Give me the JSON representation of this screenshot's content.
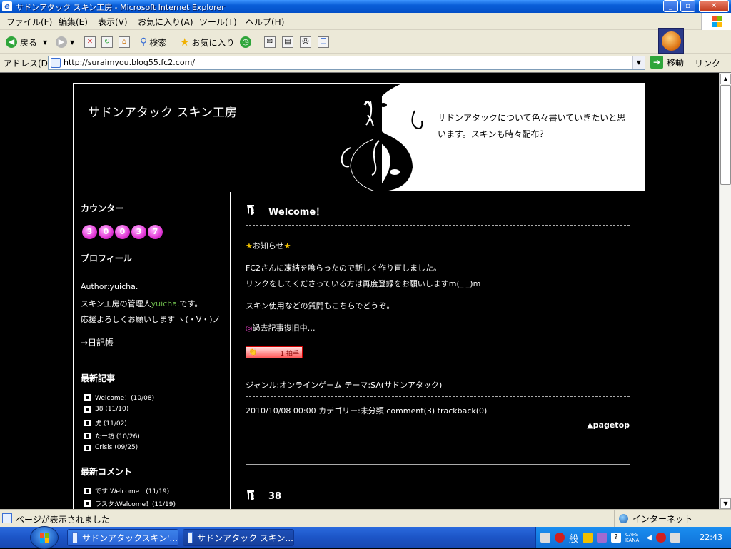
{
  "window": {
    "title": "サドンアタック スキン工房 - Microsoft Internet Explorer"
  },
  "menu": [
    "ファイル(F)",
    "編集(E)",
    "表示(V)",
    "お気に入り(A)",
    "ツール(T)",
    "ヘルプ(H)"
  ],
  "toolbar": {
    "back": "戻る",
    "search": "検索",
    "favorites": "お気に入り"
  },
  "address": {
    "label": "アドレス(D)",
    "url": "http://suraimyou.blog55.fc2.com/",
    "go": "移動",
    "links": "リンク"
  },
  "blog": {
    "title": "サドンアタック スキン工房",
    "description": "サドンアタックについて色々書いていきたいと思います。スキンも時々配布？"
  },
  "sidebar": {
    "counter_title": "カウンター",
    "counter_digits": [
      "3",
      "0",
      "0",
      "3",
      "7"
    ],
    "profile_title": "プロフィール",
    "author": "Author:yuicha.",
    "profile_line1_pre": "スキン工房の管理人",
    "profile_name": "yuicha.",
    "profile_line1_post": "です。",
    "profile_line2": "応援よろしくお願いします ヽ(・∀・)ノ",
    "diary_link": "→日記帳",
    "recent_title": "最新記事",
    "recent": [
      "Welcome！(10/08)",
      "38 (11/10)",
      "虎 (11/02)",
      "たー坊 (10/26)",
      "Crisis (09/25)"
    ],
    "comments_title": "最新コメント",
    "comments": [
      "です:Welcome！(11/19)",
      "ラスタ:Welcome！(11/19)"
    ]
  },
  "entry1": {
    "title": "Welcome！",
    "notice": "お知らせ",
    "line1": "FC2さんに凍結を喰らったので新しく作り直しました。",
    "line2": "リンクをしてくださっている方は再度登録をお願いしますm(_ _)m",
    "line3": "スキン使用などの質問もこちらでどうぞ。",
    "line4": "過去記事復旧中…",
    "clap": "1 拍手",
    "genre": "ジャンル:オンラインゲーム  テーマ:SA(サドンアタック)",
    "meta": "2010/10/08  00:00  カテゴリー:未分類 comment(3) trackback(0)",
    "pagetop": "▲pagetop"
  },
  "entry2": {
    "title": "38"
  },
  "status": {
    "text": "ページが表示されました",
    "zone": "インターネット"
  },
  "taskbar": {
    "tasks": [
      "サドンアタックスキン'...",
      "サドンアタック スキン..."
    ],
    "ime": "般",
    "caps": "CAPS",
    "kana": "KANA",
    "clock": "22:43"
  }
}
